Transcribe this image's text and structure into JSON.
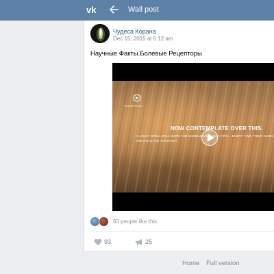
{
  "header": {
    "logo_icon": "vk-logo-icon",
    "back_icon": "arrow-left-icon",
    "title": "Wall post",
    "bg_color": "#5e81a8"
  },
  "post": {
    "author": "Чудеса Корана",
    "datetime": "Dec 15, 2015 at 5:12 am",
    "text": "Научные Факты.Болевые Рецепторы",
    "video": {
      "channel_name": "SHANFROZE",
      "headline": "NOW CONTEMPLATE OVER THIS.",
      "caption": "A LOUSY SPELL WILL BURN THE DISBELIEVERS IN A FIRE... EVERY TIME THEIR SKINS ARE ROASTED THROUGH",
      "play_icon": "play-icon"
    },
    "likes_text": "93 people like this",
    "actions": {
      "like_count": "93",
      "share_count": "25",
      "like_icon": "heart-icon",
      "share_icon": "megaphone-icon"
    }
  },
  "footer": {
    "home": "Home",
    "full_version": "Full version"
  },
  "colors": {
    "link": "#2a5885",
    "secondary_text": "#828282",
    "page_bg": "#edeef0"
  }
}
